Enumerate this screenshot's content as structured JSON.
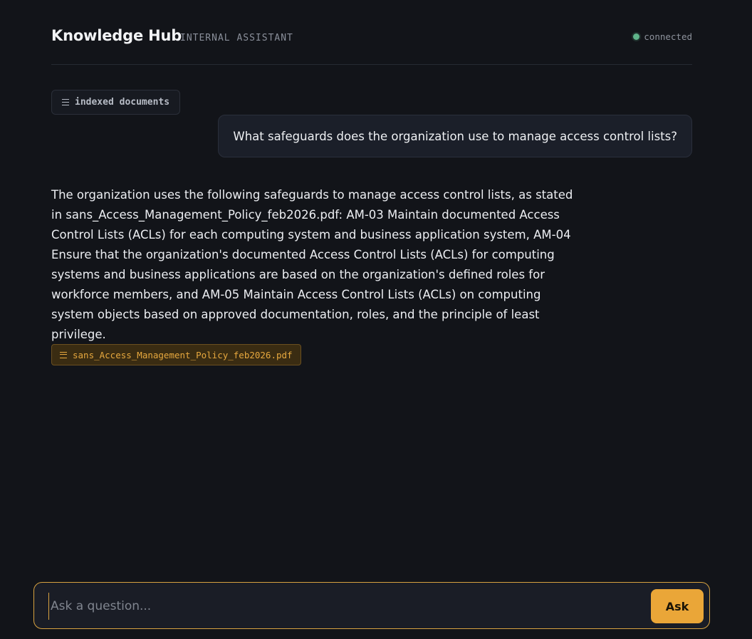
{
  "header": {
    "title": "Knowledge Hub",
    "subtitle": "INTERNAL ASSISTANT",
    "status": "connected"
  },
  "docs_chip": {
    "label": "indexed documents"
  },
  "conversation": {
    "user_message": "What safeguards does the organization use to manage access control lists?",
    "assistant_answer": "The organization uses the following safeguards to manage access control lists, as stated in sans_Access_Management_Policy_feb2026.pdf: AM-03 Maintain documented Access Control Lists (ACLs) for each computing system and business application system, AM-04 Ensure that the organization's documented Access Control Lists (ACLs) for computing systems and business applications are based on the organization's defined roles for workforce members, and AM-05 Maintain Access Control Lists (ACLs) on computing system objects based on approved documentation, roles, and the principle of least privilege.",
    "source": "sans_Access_Management_Policy_feb2026.pdf"
  },
  "composer": {
    "placeholder": "Ask a question...",
    "value": "",
    "ask_label": "Ask"
  },
  "colors": {
    "background": "#121419",
    "accent": "#eaa638",
    "status_ok": "#5fb48a"
  },
  "icons": {
    "docs_chip": "document-list-icon",
    "source_chip": "document-list-icon",
    "status": "status-dot-icon"
  }
}
